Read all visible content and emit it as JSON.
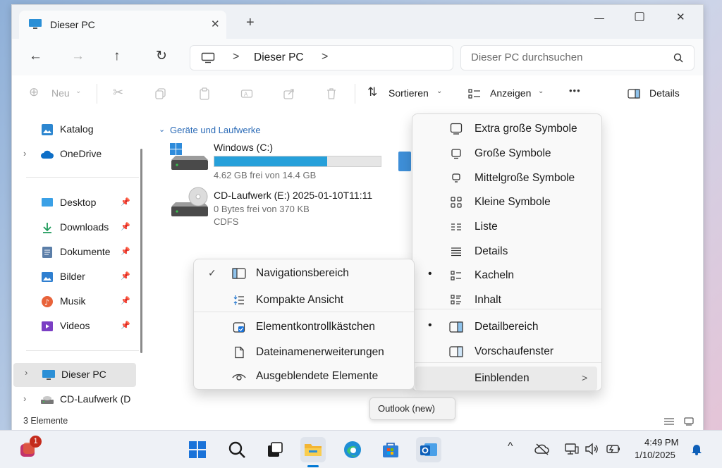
{
  "tab": {
    "title": "Dieser PC",
    "close": "✕",
    "new_tab": "+"
  },
  "window_controls": {
    "minimize": "—",
    "maximize": "▢",
    "close": "✕"
  },
  "navbar": {
    "back": "←",
    "forward": "→",
    "up": "↑",
    "refresh": "↻",
    "separator": ">",
    "location": "Dieser PC",
    "search_placeholder": "Dieser PC durchsuchen"
  },
  "commandbar": {
    "new_label": "Neu",
    "sort_label": "Sortieren",
    "view_label": "Anzeigen",
    "more": "•••",
    "details_label": "Details"
  },
  "sidebar": {
    "top_items": [
      {
        "label": "Katalog",
        "icon": "gallery-icon"
      },
      {
        "label": "OneDrive",
        "icon": "cloud-icon"
      }
    ],
    "quick_access": [
      {
        "label": "Desktop",
        "icon": "desktop-icon"
      },
      {
        "label": "Downloads",
        "icon": "download-icon"
      },
      {
        "label": "Dokumente",
        "icon": "document-icon"
      },
      {
        "label": "Bilder",
        "icon": "picture-icon"
      },
      {
        "label": "Musik",
        "icon": "music-icon"
      },
      {
        "label": "Videos",
        "icon": "video-icon"
      }
    ],
    "devices": [
      {
        "label": "Dieser PC",
        "icon": "pc-icon"
      },
      {
        "label": "CD-Laufwerk (D",
        "icon": "cd-drive-icon"
      }
    ]
  },
  "main": {
    "group_header": "Geräte und Laufwerke",
    "drives": [
      {
        "name": "Windows (C:)",
        "info": "4.62 GB frei von 14.4 GB",
        "used_fraction": 0.68
      },
      {
        "name": "CD-Laufwerk (E:) 2025-01-10T11:11",
        "info": "0 Bytes frei von 370 KB",
        "fs": "CDFS"
      }
    ]
  },
  "status": {
    "count": "3 Elemente"
  },
  "view_menu": {
    "items": [
      {
        "label": "Extra große Symbole",
        "icon": "extra-large-icons-icon"
      },
      {
        "label": "Große Symbole",
        "icon": "large-icons-icon"
      },
      {
        "label": "Mittelgroße Symbole",
        "icon": "medium-icons-icon"
      },
      {
        "label": "Kleine Symbole",
        "icon": "small-icons-icon"
      },
      {
        "label": "Liste",
        "icon": "list-icon"
      },
      {
        "label": "Details",
        "icon": "details-view-icon"
      },
      {
        "label": "Kacheln",
        "icon": "tiles-icon",
        "selected": true
      },
      {
        "label": "Inhalt",
        "icon": "content-icon"
      },
      {
        "label": "Detailbereich",
        "icon": "details-pane-icon",
        "selected": true
      },
      {
        "label": "Vorschaufenster",
        "icon": "preview-pane-icon"
      },
      {
        "label": "Einblenden",
        "icon": "",
        "submenu": true
      }
    ],
    "bullet": "•",
    "submenu_arrow": ">"
  },
  "show_menu": {
    "check": "✓",
    "items": [
      {
        "label": "Navigationsbereich",
        "icon": "navigation-pane-icon",
        "checked": true
      },
      {
        "label": "Kompakte Ansicht",
        "icon": "compact-view-icon"
      },
      {
        "label": "Elementkontrollkästchen",
        "icon": "checkbox-icon"
      },
      {
        "label": "Dateinamenerweiterungen",
        "icon": "file-extension-icon"
      },
      {
        "label": "Ausgeblendete Elemente",
        "icon": "eye-icon"
      }
    ]
  },
  "tooltip": {
    "text": "Outlook (new)"
  },
  "taskbar": {
    "notification_count": "1",
    "time": "4:49 PM",
    "date": "1/10/2025"
  },
  "colors": {
    "accent": "#0078d4",
    "drive_bar": "#26a0da",
    "sidebar_selected": "#e5e5e5"
  }
}
